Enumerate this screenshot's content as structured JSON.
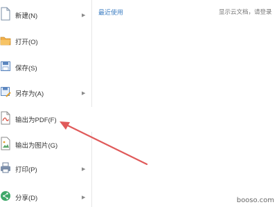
{
  "menu": {
    "items": [
      {
        "label": "新建(N)",
        "has_submenu": true,
        "icon": "new-document-icon"
      },
      {
        "label": "打开(O)",
        "has_submenu": false,
        "icon": "open-folder-icon"
      },
      {
        "label": "保存(S)",
        "has_submenu": false,
        "icon": "save-icon"
      },
      {
        "label": "另存为(A)",
        "has_submenu": true,
        "icon": "save-as-icon"
      },
      {
        "label": "输出为PDF(F)",
        "has_submenu": false,
        "icon": "pdf-icon"
      },
      {
        "label": "输出为图片(G)",
        "has_submenu": false,
        "icon": "image-export-icon"
      },
      {
        "label": "打印(P)",
        "has_submenu": true,
        "icon": "print-icon"
      },
      {
        "label": "分享(D)",
        "has_submenu": true,
        "icon": "share-icon"
      }
    ]
  },
  "recent": {
    "title": "最近使用",
    "cloud_hint": "显示云文档，请登录"
  },
  "watermark": "booso.com",
  "colors": {
    "accent_link": "#3f7fc3",
    "annotation_arrow": "#e05a5a"
  }
}
